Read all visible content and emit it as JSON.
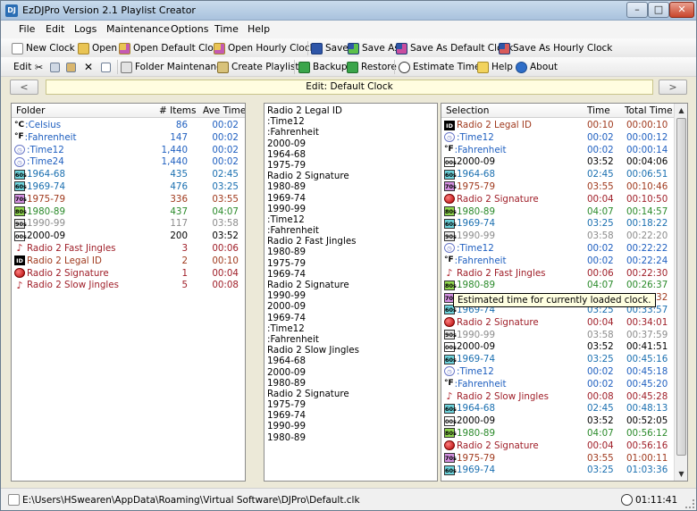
{
  "window": {
    "title": "EzDJPro Version 2.1 Playlist Creator",
    "icon_text": "DJ",
    "min": "–",
    "max": "□",
    "close": "✕"
  },
  "menu": [
    "File",
    "Edit",
    "Logs",
    "Maintenance",
    "Options",
    "Time",
    "Help"
  ],
  "toolbar1": [
    "New Clock",
    "Open",
    "Open Default Clock",
    "Open Hourly Clock",
    "Save",
    "Save As",
    "Save As Default Clock",
    "Save As Hourly Clock"
  ],
  "toolbar2": {
    "edit": "Edit",
    "folder_maintenance": "Folder Maintenance",
    "create_playlists": "Create Playlists",
    "backup": "Backup",
    "restore": "Restore",
    "estimate_time": "Estimate Time",
    "help": "Help",
    "about": "About"
  },
  "nav": {
    "prev": "<",
    "next": ">",
    "title": "Edit: Default Clock"
  },
  "left": {
    "headers": {
      "folder": "Folder",
      "items": "# Items",
      "ave": "Ave Time"
    },
    "rows": [
      {
        "icon": "°C",
        "type": "temp",
        "name": ":Celsius",
        "items": "86",
        "ave": "00:02",
        "color": "blue"
      },
      {
        "icon": "°F",
        "type": "temp",
        "name": ":Fahrenheit",
        "items": "147",
        "ave": "00:02",
        "color": "blue"
      },
      {
        "icon": "◷",
        "type": "clock",
        "name": ":Time12",
        "items": "1,440",
        "ave": "00:02",
        "color": "blue"
      },
      {
        "icon": "◷",
        "type": "clock",
        "name": ":Time24",
        "items": "1,440",
        "ave": "00:02",
        "color": "blue"
      },
      {
        "icon": "60s",
        "type": "60",
        "name": "1964-68",
        "items": "435",
        "ave": "02:45",
        "color": "cyan"
      },
      {
        "icon": "60s",
        "type": "60",
        "name": "1969-74",
        "items": "476",
        "ave": "03:25",
        "color": "cyan"
      },
      {
        "icon": "70s",
        "type": "70",
        "name": "1975-79",
        "items": "336",
        "ave": "03:55",
        "color": "brown"
      },
      {
        "icon": "80s",
        "type": "80",
        "name": "1980-89",
        "items": "437",
        "ave": "04:07",
        "color": "green"
      },
      {
        "icon": "90s",
        "type": "90",
        "name": "1990-99",
        "items": "117",
        "ave": "03:58",
        "color": "gray"
      },
      {
        "icon": "00s",
        "type": "00",
        "name": "2000-09",
        "items": "200",
        "ave": "03:52",
        "color": "black"
      },
      {
        "icon": "♪",
        "type": "note",
        "name": "Radio 2 Fast Jingles",
        "items": "3",
        "ave": "00:06",
        "color": "maroon"
      },
      {
        "icon": "ID",
        "type": "id",
        "name": "Radio 2 Legal ID",
        "items": "2",
        "ave": "00:10",
        "color": "brown"
      },
      {
        "icon": "",
        "type": "sig",
        "name": "Radio 2 Signature",
        "items": "1",
        "ave": "00:04",
        "color": "maroon"
      },
      {
        "icon": "♪",
        "type": "note",
        "name": "Radio 2 Slow Jingles",
        "items": "5",
        "ave": "00:08",
        "color": "maroon"
      }
    ]
  },
  "middle": [
    "Radio 2 Legal ID",
    ":Time12",
    ":Fahrenheit",
    "2000-09",
    "1964-68",
    "1975-79",
    "Radio 2 Signature",
    "1980-89",
    "1969-74",
    "1990-99",
    ":Time12",
    ":Fahrenheit",
    "Radio 2 Fast Jingles",
    "1980-89",
    "1975-79",
    "1969-74",
    "Radio 2 Signature",
    "1990-99",
    "2000-09",
    "1969-74",
    ":Time12",
    ":Fahrenheit",
    "Radio 2 Slow Jingles",
    "1964-68",
    "2000-09",
    "1980-89",
    "Radio 2 Signature",
    "1975-79",
    "1969-74",
    "1990-99",
    "1980-89"
  ],
  "right": {
    "headers": {
      "selection": "Selection",
      "time": "Time",
      "total": "Total Time"
    },
    "rows": [
      {
        "icon": "ID",
        "type": "id",
        "name": "Radio 2 Legal ID",
        "time": "00:10",
        "total": "00:00:10",
        "color": "brown"
      },
      {
        "icon": "◷",
        "type": "clock",
        "name": ":Time12",
        "time": "00:02",
        "total": "00:00:12",
        "color": "blue"
      },
      {
        "icon": "°F",
        "type": "temp",
        "name": ":Fahrenheit",
        "time": "00:02",
        "total": "00:00:14",
        "color": "blue"
      },
      {
        "icon": "00s",
        "type": "00",
        "name": "2000-09",
        "time": "03:52",
        "total": "00:04:06",
        "color": "black"
      },
      {
        "icon": "60s",
        "type": "60",
        "name": "1964-68",
        "time": "02:45",
        "total": "00:06:51",
        "color": "cyan"
      },
      {
        "icon": "70s",
        "type": "70",
        "name": "1975-79",
        "time": "03:55",
        "total": "00:10:46",
        "color": "brown"
      },
      {
        "icon": "",
        "type": "sig",
        "name": "Radio 2 Signature",
        "time": "00:04",
        "total": "00:10:50",
        "color": "maroon"
      },
      {
        "icon": "80s",
        "type": "80",
        "name": "1980-89",
        "time": "04:07",
        "total": "00:14:57",
        "color": "green"
      },
      {
        "icon": "60s",
        "type": "60",
        "name": "1969-74",
        "time": "03:25",
        "total": "00:18:22",
        "color": "cyan"
      },
      {
        "icon": "90s",
        "type": "90",
        "name": "1990-99",
        "time": "03:58",
        "total": "00:22:20",
        "color": "gray"
      },
      {
        "icon": "◷",
        "type": "clock",
        "name": ":Time12",
        "time": "00:02",
        "total": "00:22:22",
        "color": "blue"
      },
      {
        "icon": "°F",
        "type": "temp",
        "name": ":Fahrenheit",
        "time": "00:02",
        "total": "00:22:24",
        "color": "blue"
      },
      {
        "icon": "♪",
        "type": "note",
        "name": "Radio 2 Fast Jingles",
        "time": "00:06",
        "total": "00:22:30",
        "color": "maroon"
      },
      {
        "icon": "80s",
        "type": "80",
        "name": "1980-89",
        "time": "04:07",
        "total": "00:26:37",
        "color": "green"
      },
      {
        "icon": "70s",
        "type": "70",
        "name": "1975-79",
        "time": "03:55",
        "total": "00:30:32",
        "color": "brown"
      },
      {
        "icon": "60s",
        "type": "60",
        "name": "1969-74",
        "time": "03:25",
        "total": "00:33:57",
        "color": "cyan"
      },
      {
        "icon": "",
        "type": "sig",
        "name": "Radio 2 Signature",
        "time": "00:04",
        "total": "00:34:01",
        "color": "maroon"
      },
      {
        "icon": "90s",
        "type": "90",
        "name": "1990-99",
        "time": "03:58",
        "total": "00:37:59",
        "color": "gray"
      },
      {
        "icon": "00s",
        "type": "00",
        "name": "2000-09",
        "time": "03:52",
        "total": "00:41:51",
        "color": "black"
      },
      {
        "icon": "60s",
        "type": "60",
        "name": "1969-74",
        "time": "03:25",
        "total": "00:45:16",
        "color": "cyan"
      },
      {
        "icon": "◷",
        "type": "clock",
        "name": ":Time12",
        "time": "00:02",
        "total": "00:45:18",
        "color": "blue"
      },
      {
        "icon": "°F",
        "type": "temp",
        "name": ":Fahrenheit",
        "time": "00:02",
        "total": "00:45:20",
        "color": "blue"
      },
      {
        "icon": "♪",
        "type": "note",
        "name": "Radio 2 Slow Jingles",
        "time": "00:08",
        "total": "00:45:28",
        "color": "maroon"
      },
      {
        "icon": "60s",
        "type": "60",
        "name": "1964-68",
        "time": "02:45",
        "total": "00:48:13",
        "color": "cyan"
      },
      {
        "icon": "00s",
        "type": "00",
        "name": "2000-09",
        "time": "03:52",
        "total": "00:52:05",
        "color": "black"
      },
      {
        "icon": "80s",
        "type": "80",
        "name": "1980-89",
        "time": "04:07",
        "total": "00:56:12",
        "color": "green"
      },
      {
        "icon": "",
        "type": "sig",
        "name": "Radio 2 Signature",
        "time": "00:04",
        "total": "00:56:16",
        "color": "maroon"
      },
      {
        "icon": "70s",
        "type": "70",
        "name": "1975-79",
        "time": "03:55",
        "total": "01:00:11",
        "color": "brown"
      },
      {
        "icon": "60s",
        "type": "60",
        "name": "1969-74",
        "time": "03:25",
        "total": "01:03:36",
        "color": "cyan"
      }
    ]
  },
  "tooltip": "Estimated time for currently loaded clock.",
  "status": {
    "path": "E:\\Users\\HSwearen\\AppData\\Roaming\\Virtual Software\\DJPro\\Default.clk",
    "time": "01:11:41"
  },
  "scroll": {
    "up": "▲",
    "down": "▼"
  }
}
